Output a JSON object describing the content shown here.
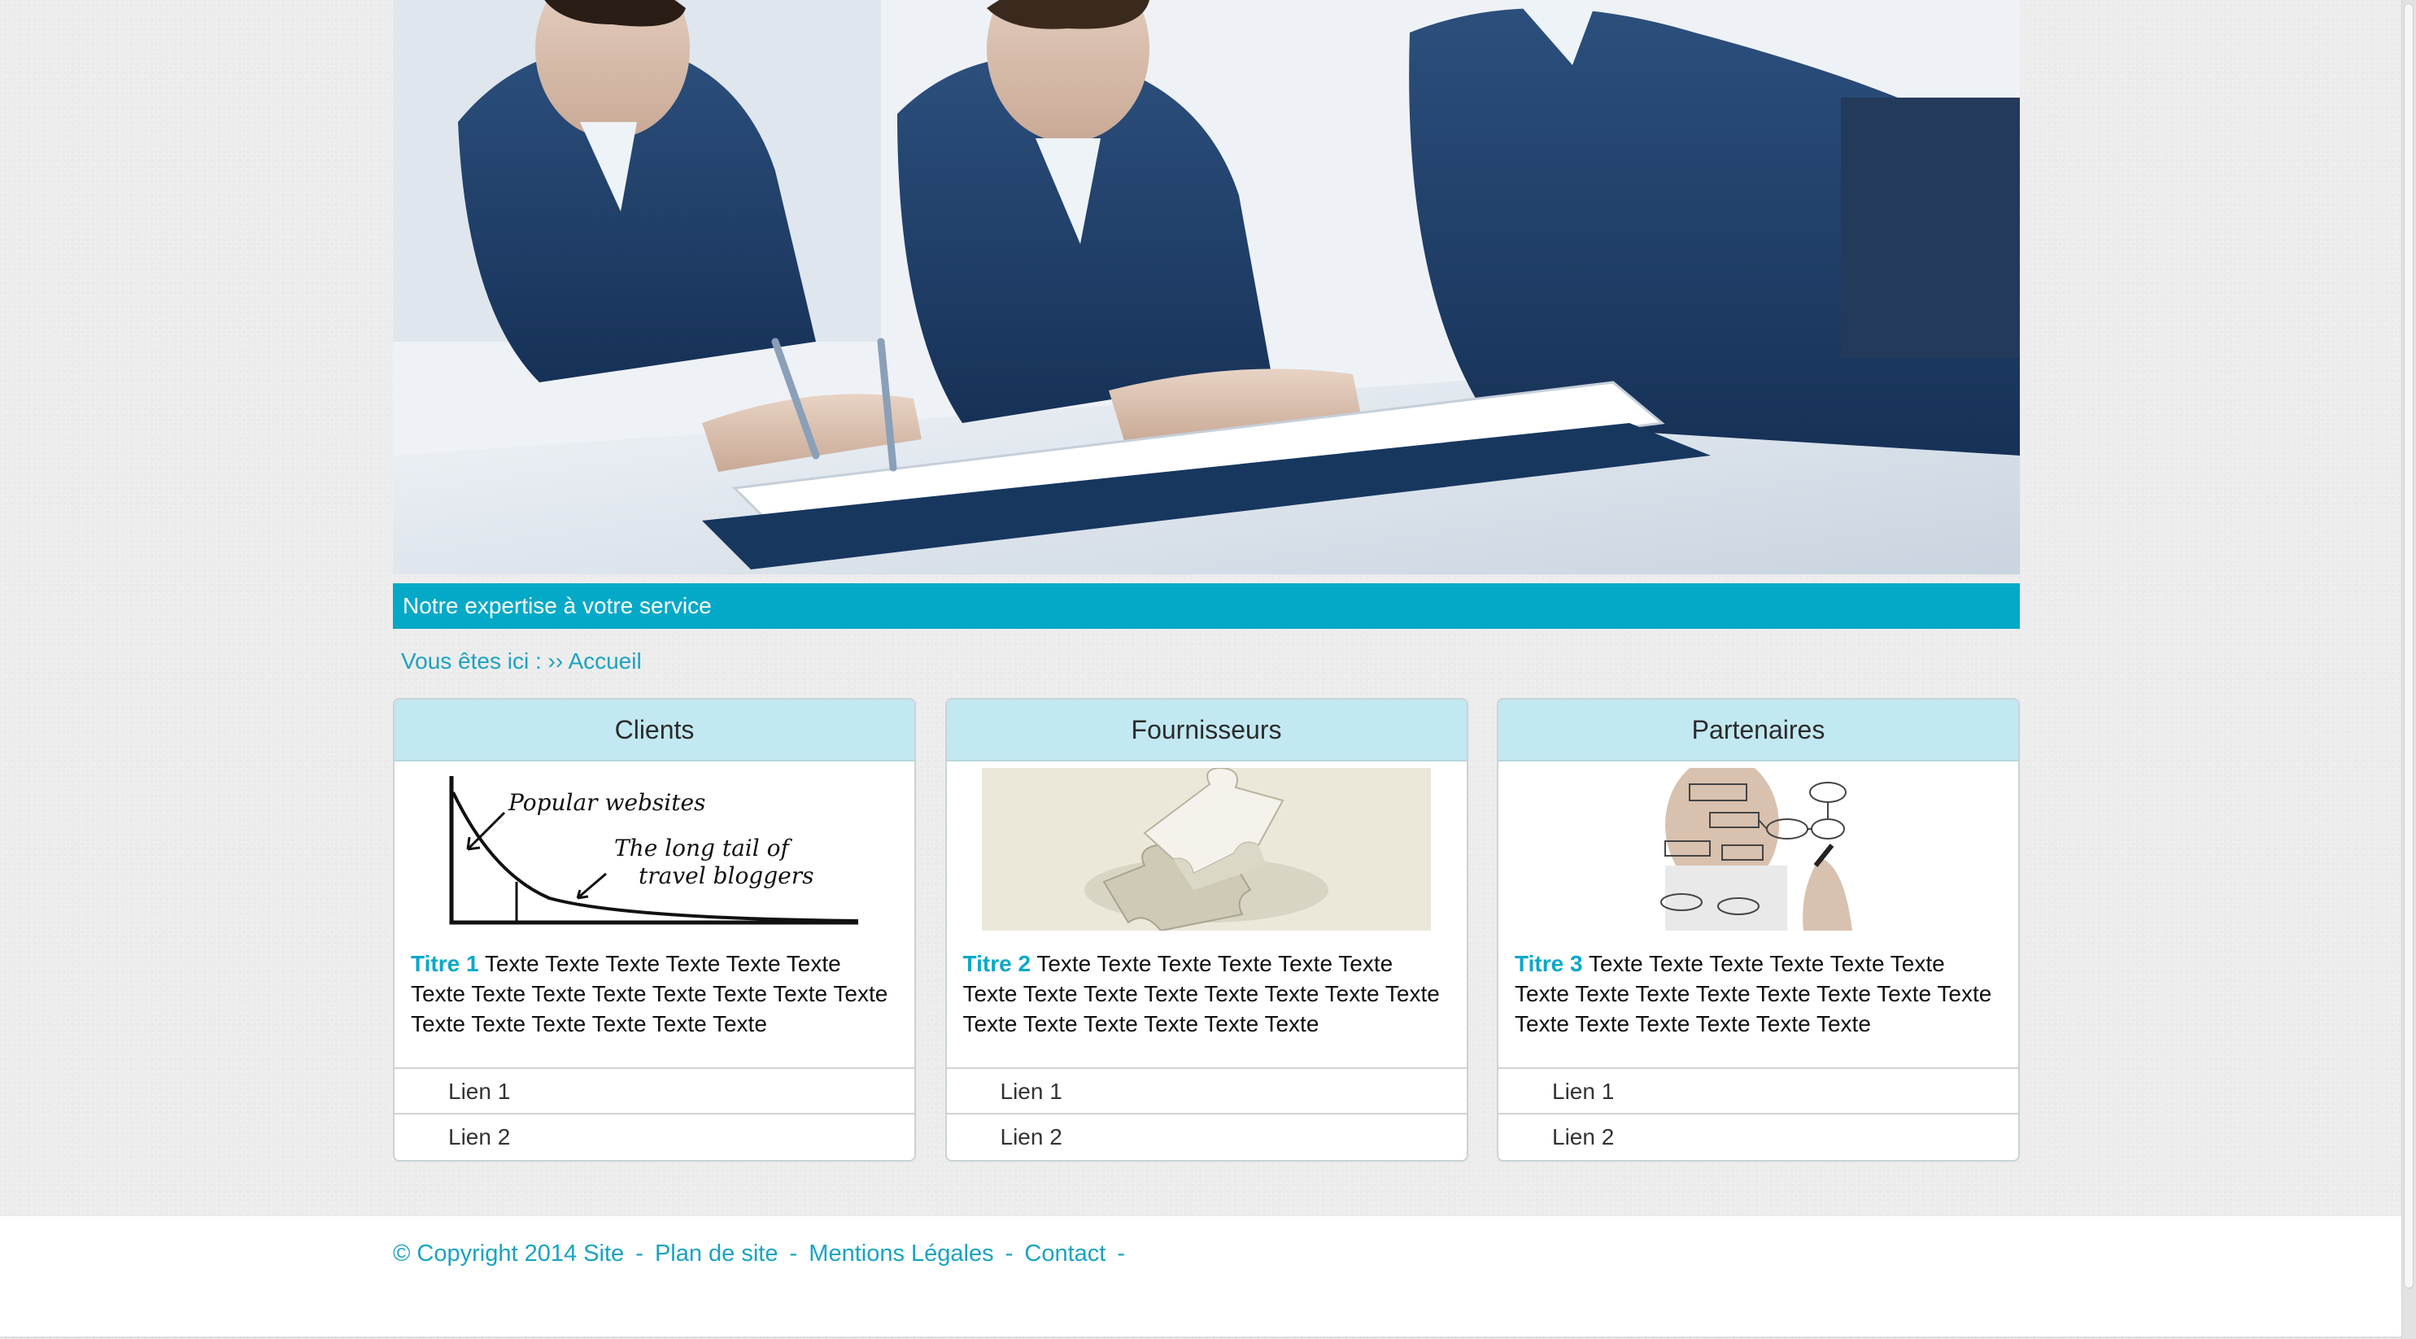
{
  "banner": {
    "tagline": "Notre expertise à votre service"
  },
  "breadcrumb": {
    "prefix": "Vous êtes ici :",
    "separator": "››",
    "current": "Accueil"
  },
  "cards": [
    {
      "title": "Clients",
      "image_icon": "long-tail-chart-sketch",
      "chart_caption_1": "Popular websites",
      "chart_caption_2": "The long tail of",
      "chart_caption_3": "travel bloggers",
      "heading": "Titre 1",
      "text": "Texte Texte Texte Texte Texte Texte Texte Texte Texte Texte Texte Texte Texte Texte Texte Texte Texte Texte Texte Texte",
      "links": [
        "Lien 1",
        "Lien 2"
      ]
    },
    {
      "title": "Fournisseurs",
      "image_icon": "puzzle-piece",
      "heading": "Titre 2",
      "text": "Texte Texte Texte Texte Texte Texte Texte Texte Texte Texte Texte Texte Texte Texte Texte Texte Texte Texte Texte Texte",
      "links": [
        "Lien 1",
        "Lien 2"
      ]
    },
    {
      "title": "Partenaires",
      "image_icon": "flowchart-drawing",
      "heading": "Titre 3",
      "text": "Texte Texte Texte Texte Texte Texte Texte Texte Texte Texte Texte Texte Texte Texte Texte Texte Texte Texte Texte Texte",
      "links": [
        "Lien 1",
        "Lien 2"
      ]
    }
  ],
  "footer": {
    "copyright": "© Copyright 2014 Site",
    "plan": "Plan de site",
    "mentions": "Mentions Légales",
    "contact": "Contact",
    "separator": "-"
  },
  "colors": {
    "accent": "#04a9c7",
    "card_header": "#c2e8f1",
    "link": "#1aa3c0"
  }
}
